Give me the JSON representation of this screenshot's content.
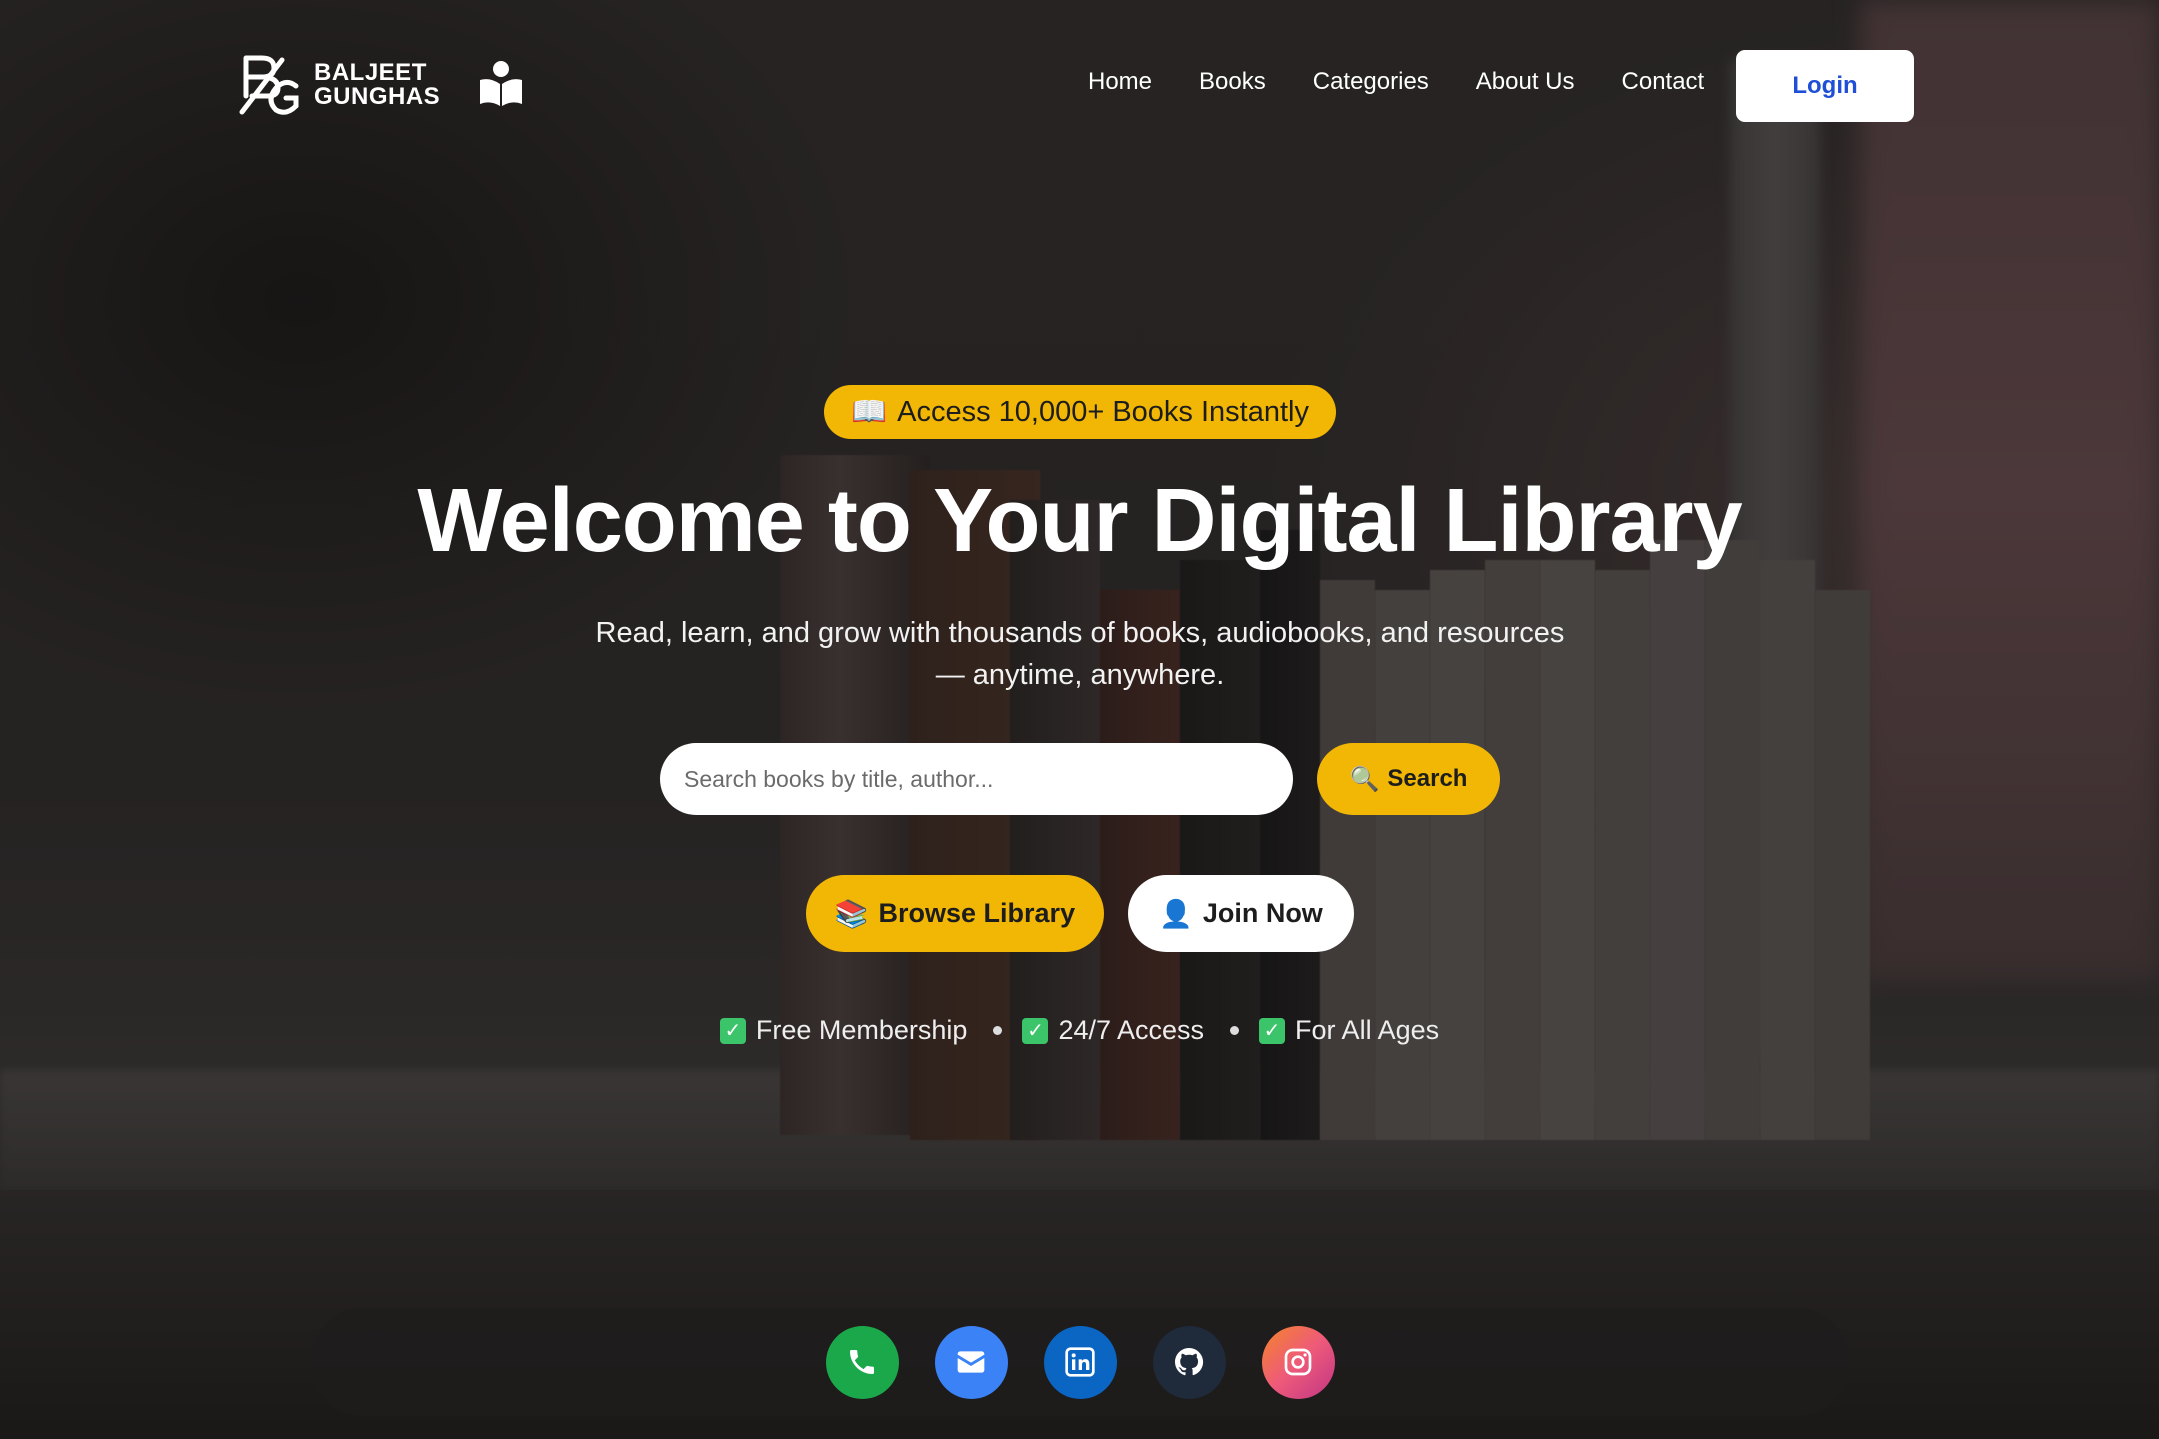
{
  "brand": {
    "name_line1": "BALJEET",
    "name_line2": "GUNGHAS",
    "monogram_icon": "bg-monogram-logo",
    "reader_icon": "person-reading-icon"
  },
  "nav": {
    "items": [
      "Home",
      "Books",
      "Categories",
      "About Us",
      "Contact"
    ],
    "login_label": "Login"
  },
  "hero": {
    "badge_emoji": "📖",
    "badge_text": "Access 10,000+ Books Instantly",
    "title": "Welcome to Your Digital Library",
    "subtitle_line1": "Read, learn, and grow with thousands of books, audiobooks, and resources",
    "subtitle_line2": "— anytime, anywhere."
  },
  "search": {
    "placeholder": "Search books by title, author...",
    "value": "",
    "button_emoji": "🔍",
    "button_label": "Search"
  },
  "cta": {
    "browse_emoji": "📚",
    "browse_label": "Browse Library",
    "join_emoji": "👤",
    "join_label": "Join Now"
  },
  "features": [
    "Free Membership",
    "24/7 Access",
    "For All Ages"
  ],
  "social": [
    {
      "name": "phone-icon",
      "color": "#1aa84a"
    },
    {
      "name": "email-icon",
      "color": "#3b82f6"
    },
    {
      "name": "linkedin-icon",
      "color": "#0a66c2"
    },
    {
      "name": "github-icon",
      "color": "#1f2a3a"
    },
    {
      "name": "instagram-icon",
      "color": "#ee5a7a"
    }
  ],
  "colors": {
    "accent": "#f2b705",
    "login_text": "#1f4fd6",
    "check": "#3cc46a"
  }
}
